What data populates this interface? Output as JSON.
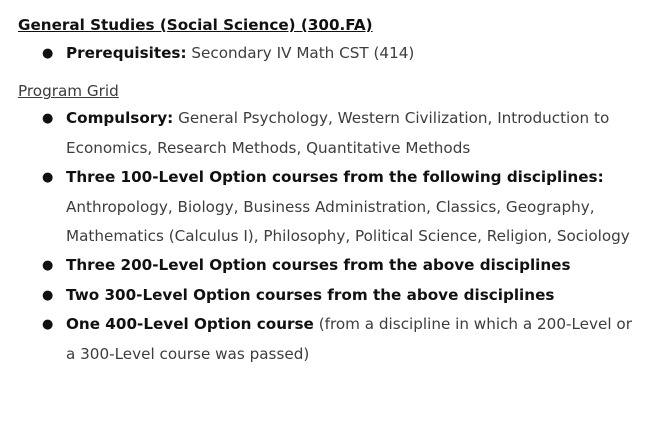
{
  "heading": "General Studies (Social Science) (300.FA)",
  "prerequisites": {
    "label": "Prerequisites:",
    "text": "Secondary IV Math CST (414)"
  },
  "program_grid": {
    "link": "Program Grid",
    "items": [
      {
        "label": "Compulsory:",
        "text": "General Psychology, Western Civilization, Introduction to Economics, Research Methods, Quantitative Methods"
      },
      {
        "label": "Three 100-Level Option courses from the following disciplines:",
        "text": "Anthropology, Biology, Business Administration, Classics, Geography, Mathematics (Calculus I), Philosophy, Political Science, Religion, Sociology"
      },
      {
        "label": "Three 200-Level Option courses from the above disciplines",
        "text": ""
      },
      {
        "label": "Two 300-Level Option courses from the above disciplines",
        "text": ""
      },
      {
        "label": "One 400-Level Option course",
        "text": "(from a discipline in which a 200-Level or a 300-Level course was passed)"
      }
    ]
  }
}
